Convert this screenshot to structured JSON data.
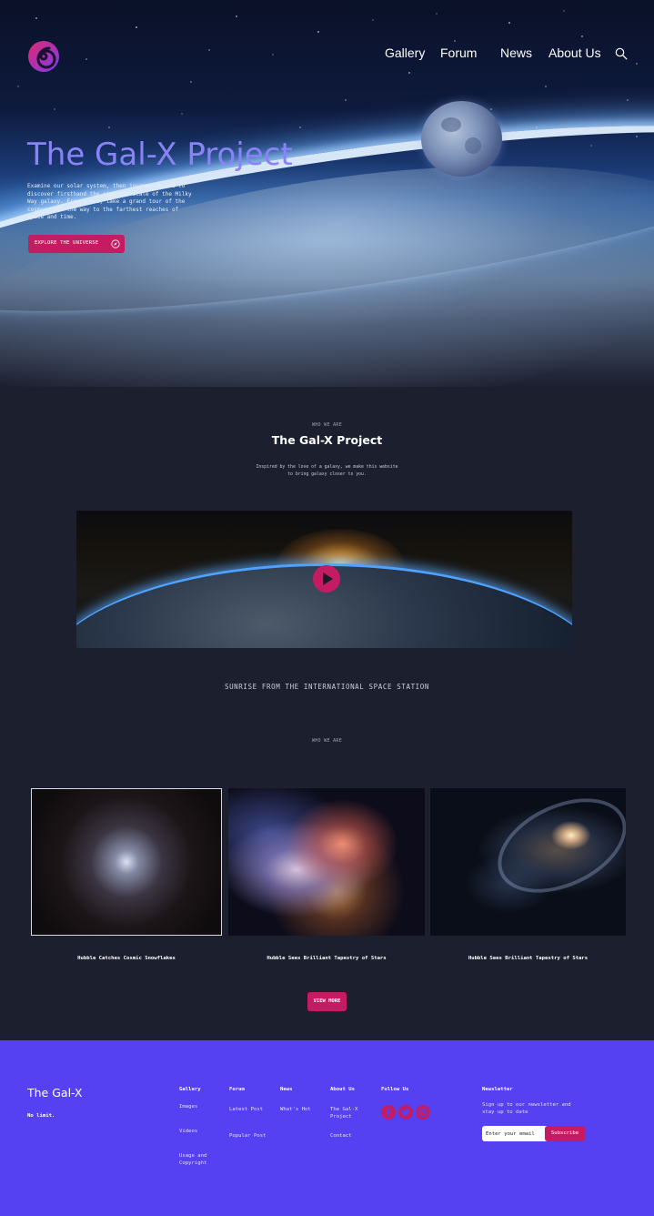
{
  "nav": {
    "items": [
      "Gallery",
      "Forum",
      "News",
      "About Us"
    ]
  },
  "hero": {
    "title": "The Gal-X Project",
    "description": "Examine our solar system, then journey onward to discover firsthand the size and scale of the Milky Way galaxy. From there, take a grand tour of the cosmos, all the way to the farthest reaches of space and time.",
    "cta_label": "EXPLORE THE UNIVERSE"
  },
  "about": {
    "eyebrow": "WHO WE ARE",
    "title": "The Gal-X Project",
    "description": "Inspired by the love of a galaxy, we make this website to bring galaxy closer to you."
  },
  "video": {
    "caption": "SUNRISE FROM THE INTERNATIONAL SPACE STATION"
  },
  "gallery": {
    "eyebrow": "WHO WE ARE",
    "cards": [
      {
        "title": "Hubble Catches Cosmic Snowflakes"
      },
      {
        "title": "Hubble Sees Brilliant Tapestry of Stars"
      },
      {
        "title": "Hubble Sees Brilliant Tapestry of Stars"
      }
    ],
    "view_more_label": "VIEW MORE"
  },
  "footer": {
    "brand": "The Gal-X",
    "tagline": "No limit.",
    "columns": {
      "gallery": {
        "heading": "Gallery",
        "links": [
          "Images",
          "Videos",
          "Usage and Copyright"
        ]
      },
      "forum": {
        "heading": "Forum",
        "links": [
          "Latest Post",
          "Popular Post"
        ]
      },
      "news": {
        "heading": "News",
        "links": [
          "What's Hot"
        ]
      },
      "about": {
        "heading": "About Us",
        "links": [
          "The Gal-X Project",
          "Contact"
        ]
      },
      "follow": {
        "heading": "Follow Us",
        "icons": [
          "facebook-icon",
          "twitter-icon",
          "instagram-icon"
        ]
      }
    },
    "newsletter": {
      "heading": "Newsletter",
      "text": "Sign up to our newsletter and stay up to date",
      "placeholder": "Enter your email",
      "button_label": "Subscribe"
    }
  },
  "colors": {
    "accent": "#c41c62",
    "title": "#8a83f5",
    "footer_bg": "#5540f2",
    "page_bg": "#1c1f2e"
  }
}
